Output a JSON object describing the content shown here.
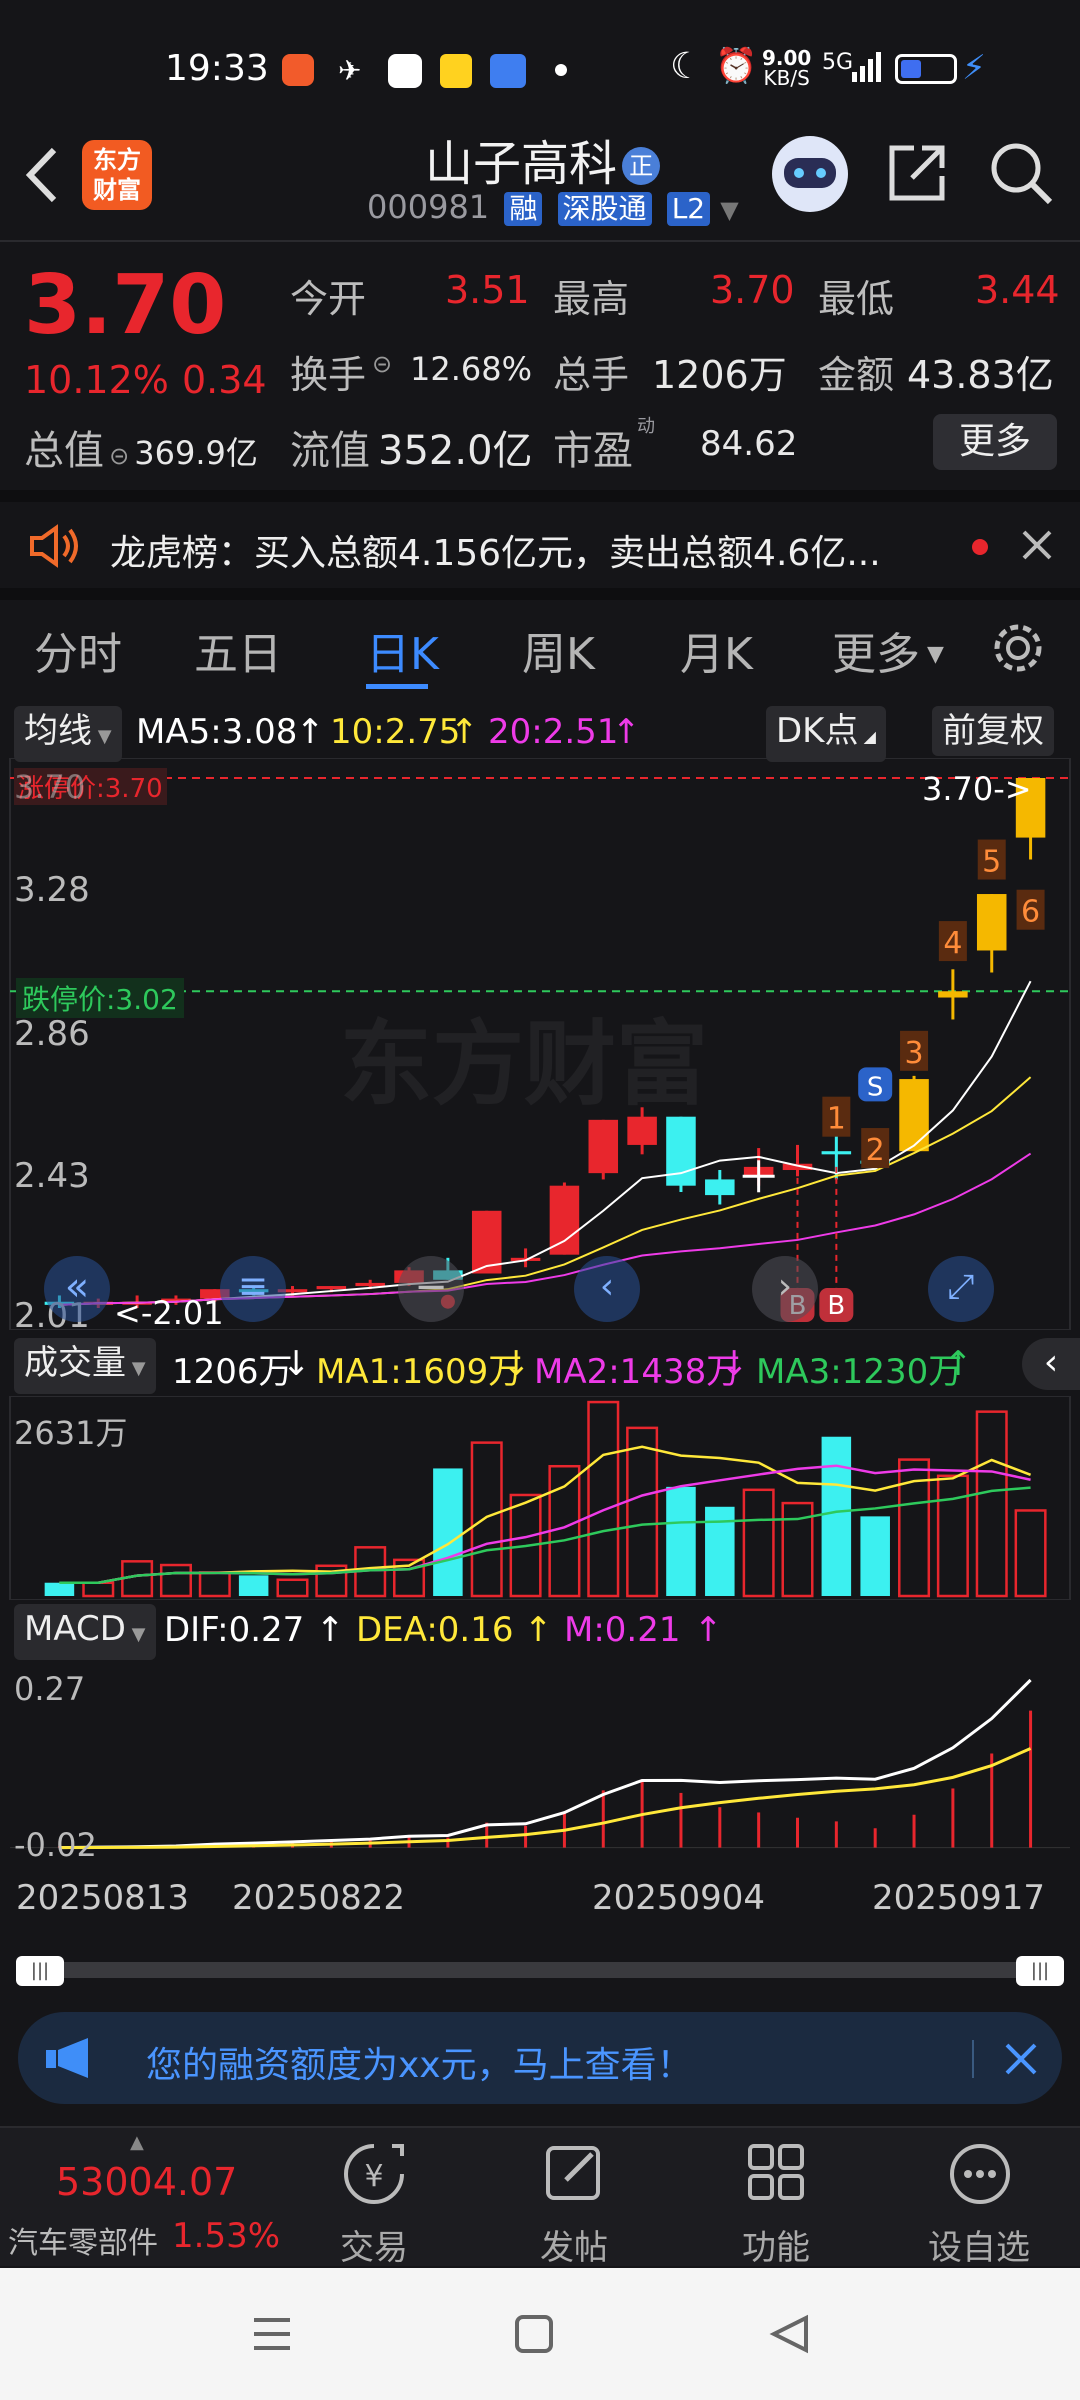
{
  "status_bar": {
    "time": "19:33",
    "speed_value": "9.00",
    "speed_unit": "KB/S",
    "net": "5G"
  },
  "header": {
    "logo_line1": "东方",
    "logo_line2": "财富",
    "title": "山子高科",
    "badge": "正",
    "code": "000981",
    "tags": [
      "融",
      "深股通",
      "L2"
    ]
  },
  "quote": {
    "price": "3.70",
    "change_pct": "10.12%",
    "change_abs": "0.34",
    "open_label": "今开",
    "open": "3.51",
    "high_label": "最高",
    "high": "3.70",
    "low_label": "最低",
    "low": "3.44",
    "turnover_label": "换手",
    "turnover": "12.68%",
    "volume_label": "总手",
    "volume": "1206万",
    "amount_label": "金额",
    "amount": "43.83亿",
    "mktcap_label": "总值",
    "mktcap": "369.9亿",
    "float_label": "流值",
    "float": "352.0亿",
    "pe_label": "市盈",
    "pe_sup": "动",
    "pe": "84.62",
    "more": "更多"
  },
  "announcement": {
    "text": "龙虎榜：买入总额4.156亿元，卖出总额4.6亿..."
  },
  "tabs": {
    "items": [
      "分时",
      "五日",
      "日K",
      "周K",
      "月K",
      "更多"
    ],
    "active": "日K"
  },
  "ma_bar": {
    "selector": "均线",
    "ma5": "MA5:3.08",
    "ma10": "10:2.75",
    "ma20": "20:2.51",
    "dk": "DK点",
    "adjust": "前复权"
  },
  "main_chart": {
    "y_top": "3.70",
    "y_labels": [
      "3.28",
      "2.86",
      "2.43",
      "2.01"
    ],
    "limit_up": "涨停价:3.70",
    "limit_down": "跌停价:3.02",
    "watermark": "东方财富",
    "current_marker": "3.70->",
    "min_marker": "<-2.01",
    "signal_s": "S",
    "signal_b": "B",
    "counts": [
      "1",
      "2",
      "3",
      "4",
      "5",
      "6"
    ]
  },
  "volume_bar": {
    "selector": "成交量",
    "vol": "1206万",
    "ma1": "MA1:1609万",
    "ma2": "MA2:1438万",
    "ma3": "MA3:1230万",
    "top_label": "2631万"
  },
  "macd_bar": {
    "selector": "MACD",
    "dif": "DIF:0.27",
    "dea": "DEA:0.16",
    "m": "M:0.21",
    "top": "0.27",
    "bottom": "-0.02"
  },
  "dates": [
    "20250813",
    "20250822",
    "20250904",
    "20250917"
  ],
  "promo": {
    "text": "您的融资额度为xx元，马上查看！"
  },
  "bottom_nav": {
    "index_value": "53004.07",
    "index_name": "汽车零部件",
    "index_pct": "1.53%",
    "items": [
      "交易",
      "发帖",
      "功能",
      "设自选"
    ]
  },
  "chart_data": {
    "type": "candlestick",
    "x": [
      "20250813",
      "20250822",
      "20250904",
      "20250917"
    ],
    "ylim": [
      2.01,
      3.7
    ],
    "candles": [
      {
        "o": 2.03,
        "h": 2.05,
        "l": 2.01,
        "c": 2.02
      },
      {
        "o": 2.02,
        "h": 2.04,
        "l": 2.01,
        "c": 2.03
      },
      {
        "o": 2.03,
        "h": 2.05,
        "l": 2.01,
        "c": 2.03
      },
      {
        "o": 2.03,
        "h": 2.05,
        "l": 2.02,
        "c": 2.04
      },
      {
        "o": 2.04,
        "h": 2.07,
        "l": 2.03,
        "c": 2.07
      },
      {
        "o": 2.07,
        "h": 2.08,
        "l": 2.05,
        "c": 2.06
      },
      {
        "o": 2.06,
        "h": 2.08,
        "l": 2.05,
        "c": 2.07
      },
      {
        "o": 2.07,
        "h": 2.08,
        "l": 2.06,
        "c": 2.08
      },
      {
        "o": 2.08,
        "h": 2.1,
        "l": 2.07,
        "c": 2.09
      },
      {
        "o": 2.09,
        "h": 2.14,
        "l": 2.08,
        "c": 2.13
      },
      {
        "o": 2.13,
        "h": 2.17,
        "l": 2.1,
        "c": 2.1
      },
      {
        "o": 2.12,
        "h": 2.32,
        "l": 2.12,
        "c": 2.32
      },
      {
        "o": 2.16,
        "h": 2.2,
        "l": 2.14,
        "c": 2.17
      },
      {
        "o": 2.18,
        "h": 2.41,
        "l": 2.18,
        "c": 2.4
      },
      {
        "o": 2.44,
        "h": 2.61,
        "l": 2.42,
        "c": 2.61
      },
      {
        "o": 2.53,
        "h": 2.65,
        "l": 2.5,
        "c": 2.62
      },
      {
        "o": 2.62,
        "h": 2.62,
        "l": 2.38,
        "c": 2.4
      },
      {
        "o": 2.42,
        "h": 2.45,
        "l": 2.34,
        "c": 2.37
      },
      {
        "o": 2.43,
        "h": 2.52,
        "l": 2.4,
        "c": 2.46
      },
      {
        "o": 2.45,
        "h": 2.53,
        "l": 2.43,
        "c": 2.47
      },
      {
        "o": 2.51,
        "h": 2.65,
        "l": 2.42,
        "c": 2.5
      },
      {
        "o": 2.48,
        "h": 2.48,
        "l": 2.45,
        "c": 2.47
      },
      {
        "o": 2.51,
        "h": 2.75,
        "l": 2.51,
        "c": 2.74
      },
      {
        "o": 3.0,
        "h": 3.09,
        "l": 2.93,
        "c": 3.02
      },
      {
        "o": 3.15,
        "h": 3.33,
        "l": 3.08,
        "c": 3.33
      },
      {
        "o": 3.51,
        "h": 3.7,
        "l": 3.44,
        "c": 3.7
      }
    ],
    "volume": [
      1.8,
      1.8,
      4.7,
      4.2,
      3.2,
      2.8,
      2.2,
      4.1,
      6.6,
      4.9,
      17.3,
      20.8,
      13.7,
      17.6,
      26.3,
      22.8,
      14.8,
      12.1,
      14.4,
      12.6,
      21.6,
      10.8,
      18.5,
      16.3,
      25.0,
      11.6
    ]
  }
}
